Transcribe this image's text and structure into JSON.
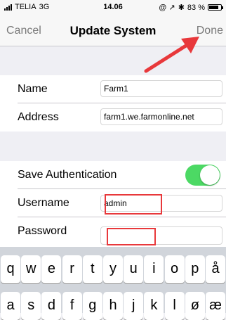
{
  "status_bar": {
    "carrier": "TELIA",
    "network": "3G",
    "time": "14.06",
    "battery": "83 %",
    "battery_level": 0.83
  },
  "nav": {
    "cancel": "Cancel",
    "title": "Update System",
    "done": "Done"
  },
  "form": {
    "name_label": "Name",
    "name_value": "Farm1",
    "address_label": "Address",
    "address_value": "farm1.we.farmonline.net",
    "save_auth_label": "Save Authentication",
    "save_auth_on": true,
    "username_label": "Username",
    "username_value": "admin",
    "password_label": "Password",
    "password_value": ""
  },
  "keyboard": {
    "row1": [
      "q",
      "w",
      "e",
      "r",
      "t",
      "y",
      "u",
      "i",
      "o",
      "p",
      "å"
    ],
    "row2": [
      "a",
      "s",
      "d",
      "f",
      "g",
      "h",
      "j",
      "k",
      "l",
      "ø",
      "æ"
    ]
  },
  "colors": {
    "toggle_on": "#4cd964",
    "highlight_red": "#e8383b"
  }
}
